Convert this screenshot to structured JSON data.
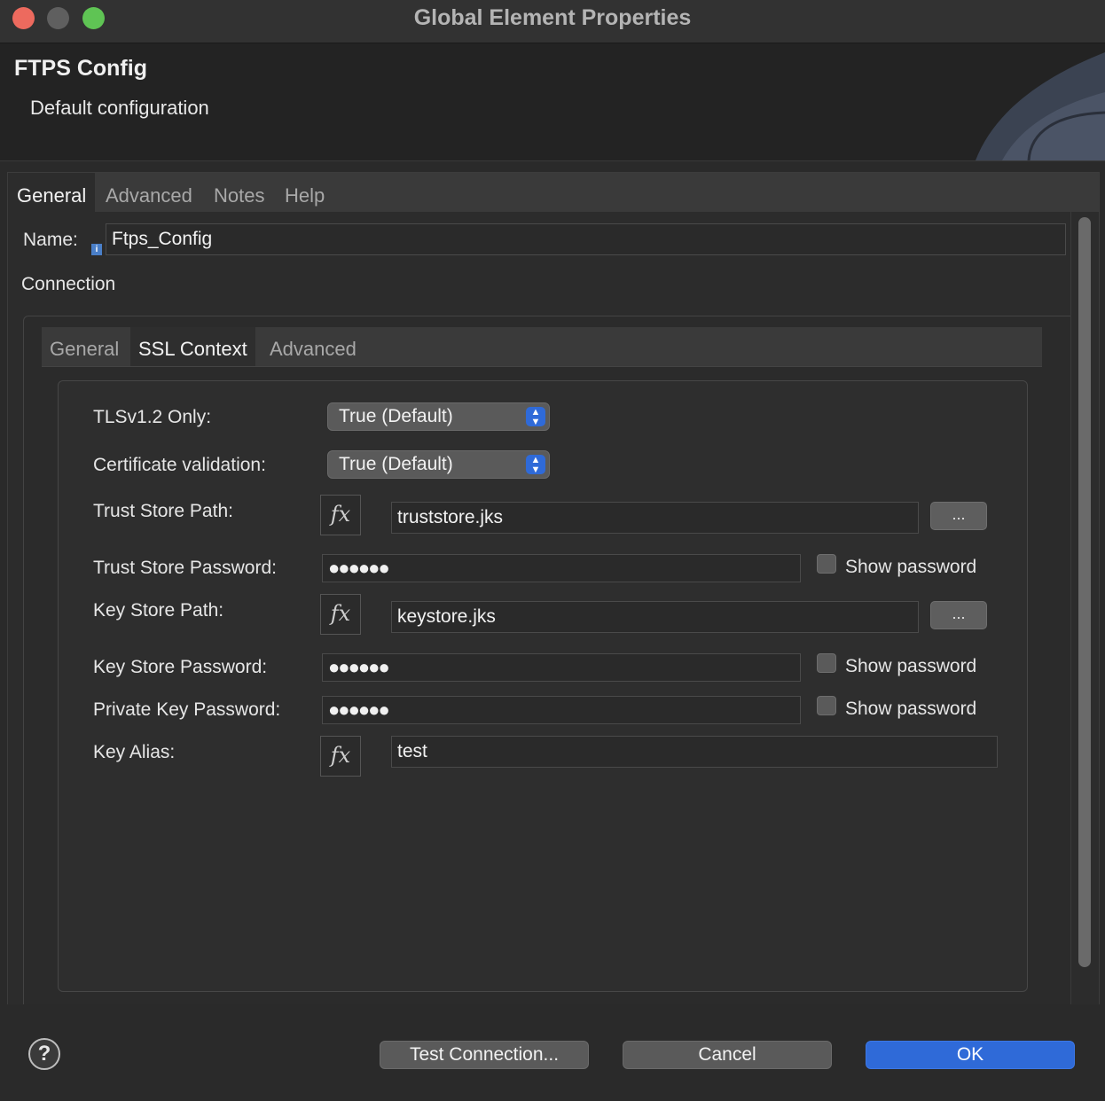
{
  "window": {
    "title": "Global Element Properties"
  },
  "header": {
    "title": "FTPS Config",
    "subtitle": "Default configuration"
  },
  "tabs": [
    {
      "label": "General",
      "active": true
    },
    {
      "label": "Advanced",
      "active": false
    },
    {
      "label": "Notes",
      "active": false
    },
    {
      "label": "Help",
      "active": false
    }
  ],
  "name": {
    "label": "Name:",
    "value": "Ftps_Config",
    "info_icon": "info-icon"
  },
  "connection": {
    "label": "Connection",
    "tabs": [
      {
        "label": "General",
        "active": false
      },
      {
        "label": "SSL Context",
        "active": true
      },
      {
        "label": "Advanced",
        "active": false
      }
    ],
    "fields": {
      "tls": {
        "label": "TLSv1.2 Only:",
        "value": "True (Default)"
      },
      "cert_validation": {
        "label": "Certificate validation:",
        "value": "True (Default)"
      },
      "trust_store_path": {
        "label": "Trust Store Path:",
        "value": "truststore.jks",
        "fx": "fx",
        "browse": "..."
      },
      "trust_store_password": {
        "label": "Trust Store Password:",
        "masked": "●●●●●●",
        "show_label": "Show password",
        "checked": false
      },
      "key_store_path": {
        "label": "Key Store Path:",
        "value": "keystore.jks",
        "fx": "fx",
        "browse": "..."
      },
      "key_store_password": {
        "label": "Key Store Password:",
        "masked": "●●●●●●",
        "show_label": "Show password",
        "checked": false
      },
      "private_key_password": {
        "label": "Private Key Password:",
        "masked": "●●●●●●",
        "show_label": "Show password",
        "checked": false
      },
      "key_alias": {
        "label": "Key Alias:",
        "value": "test",
        "fx": "fx"
      }
    }
  },
  "footer": {
    "help": "?",
    "test_connection": "Test Connection...",
    "cancel": "Cancel",
    "ok": "OK"
  },
  "colors": {
    "accent": "#2f6ad8",
    "close": "#ed6a5e",
    "maximize": "#5fc454"
  }
}
